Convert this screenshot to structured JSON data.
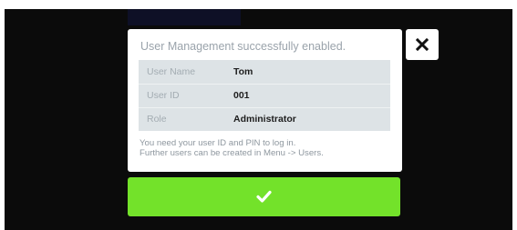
{
  "dialog": {
    "title": "User Management successfully enabled.",
    "fields": [
      {
        "label": "User Name",
        "value": "Tom"
      },
      {
        "label": "User ID",
        "value": "001"
      },
      {
        "label": "Role",
        "value": "Administrator"
      }
    ],
    "hint_line1": "You need your user ID and PIN to log in.",
    "hint_line2": "Further users can be created in Menu -> Users."
  },
  "buttons": {
    "close_icon": "close-icon",
    "confirm_icon": "checkmark-icon"
  },
  "colors": {
    "screen_bg": "#0b0b0b",
    "confirm_green": "#73e22a",
    "table_bg": "#dde3e6",
    "muted_text": "#9aa3ab"
  }
}
